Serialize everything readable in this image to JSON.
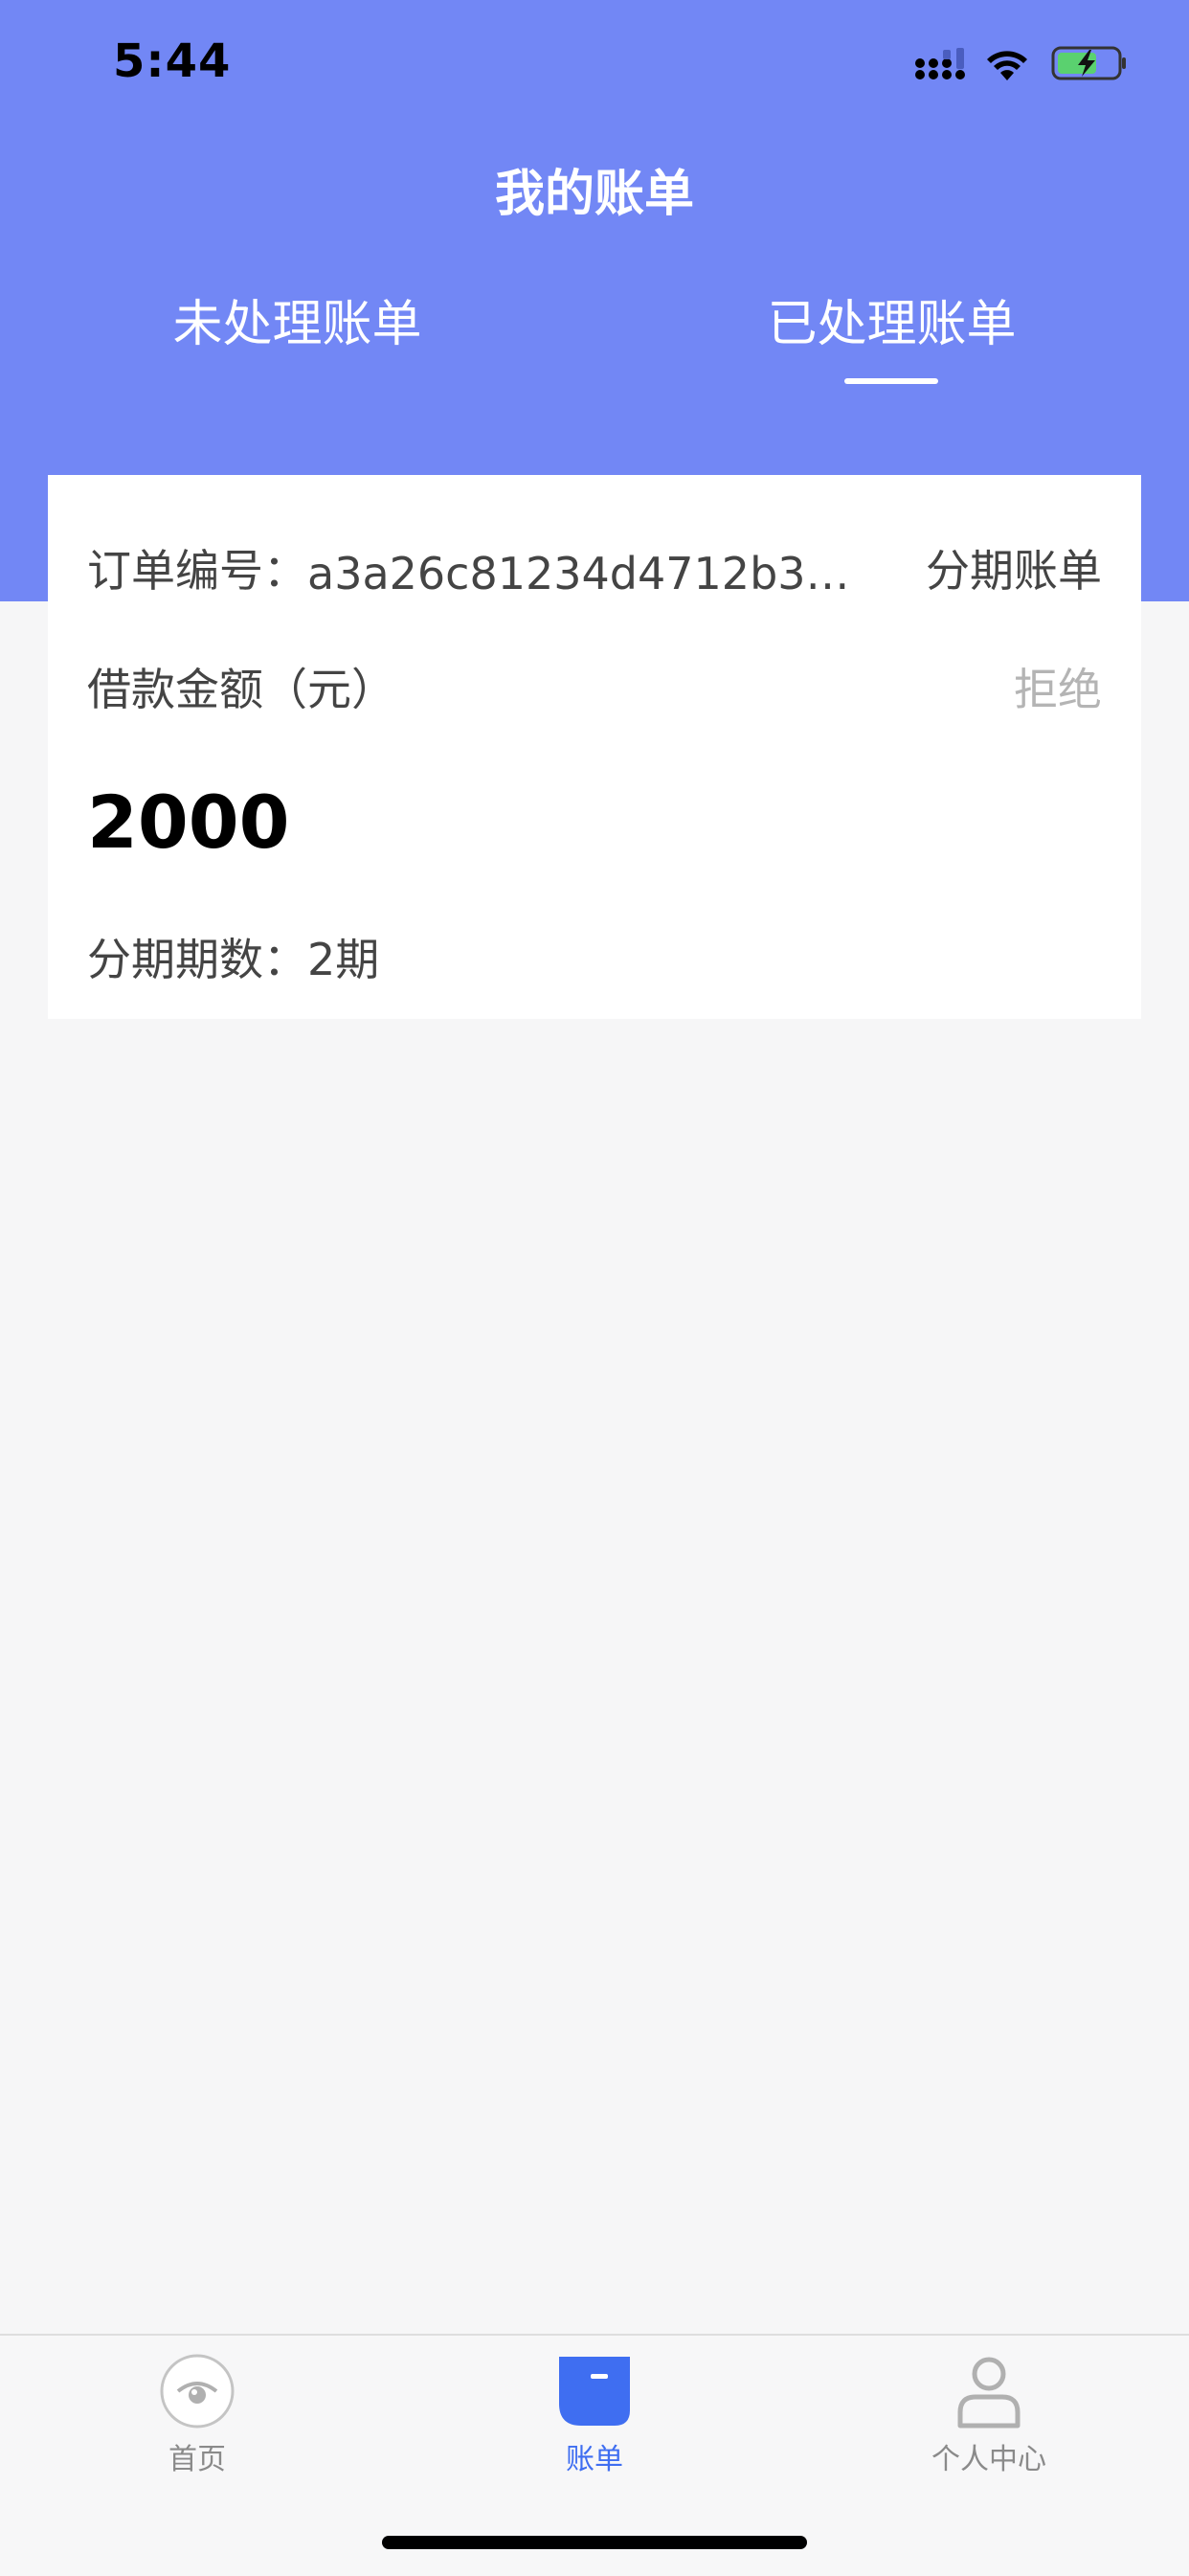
{
  "status_bar": {
    "time": "5:44"
  },
  "header": {
    "title": "我的账单",
    "tabs": [
      {
        "label": "未处理账单",
        "active": false
      },
      {
        "label": "已处理账单",
        "active": true
      }
    ]
  },
  "bill_card": {
    "order_label": "订单编号：",
    "order_value": "a3a26c81234d4712b316...",
    "order_type": "分期账单",
    "amount_label": "借款金额（元）",
    "status": "拒绝",
    "amount": "2000",
    "installments_label": "分期期数：",
    "installments_value": "2期"
  },
  "tabbar": {
    "items": [
      {
        "label": "首页",
        "icon": "home-eye-icon",
        "active": false
      },
      {
        "label": "账单",
        "icon": "bill-icon",
        "active": true
      },
      {
        "label": "个人中心",
        "icon": "profile-icon",
        "active": false
      }
    ]
  },
  "colors": {
    "header_bg": "#7287f5",
    "accent": "#3f6ef1",
    "status_reject": "#b4b4b4",
    "page_bg": "#f6f6f7"
  }
}
